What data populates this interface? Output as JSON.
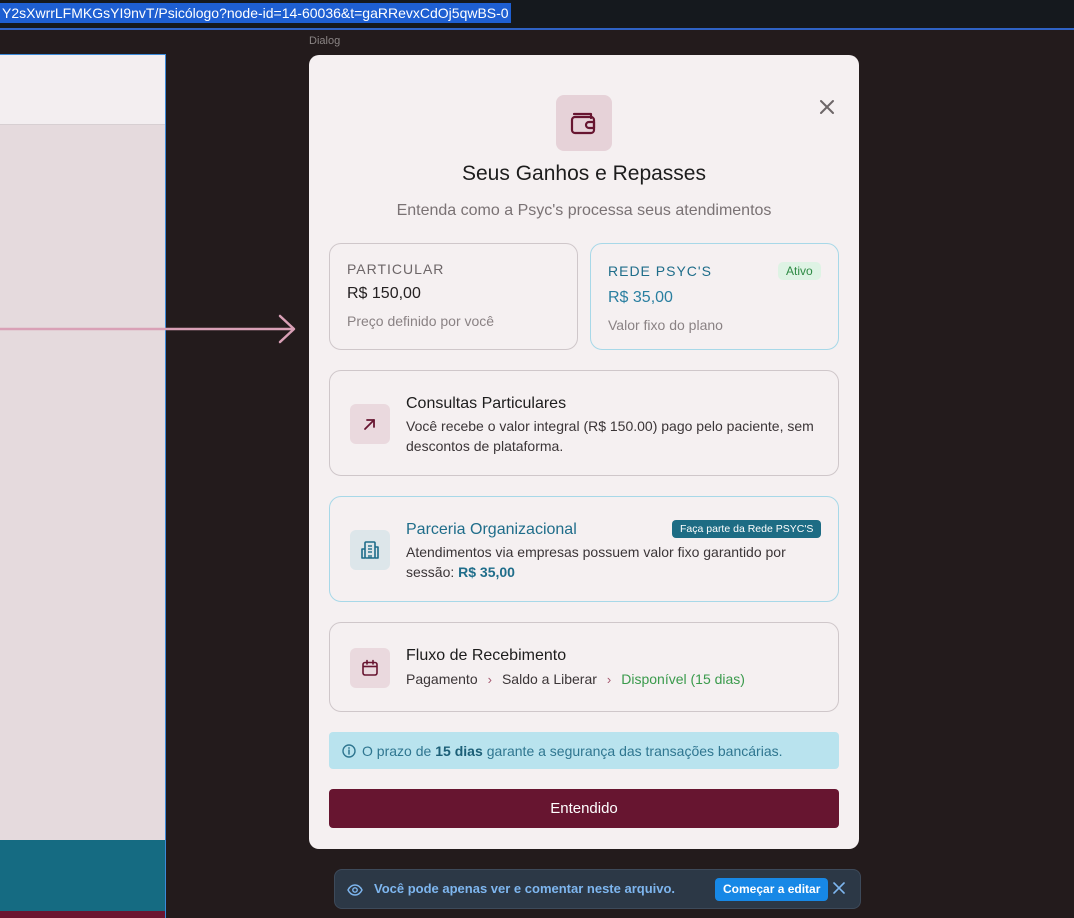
{
  "browser": {
    "url": "Y2sXwrrLFMKGsYI9nvT/Psicólogo?node-id=14-60036&t=gaRRevxCdOj5qwBS-0"
  },
  "canvas": {
    "frame_label": "Dialog"
  },
  "dialog": {
    "title": "Seus Ganhos e Repasses",
    "subtitle": "Entenda como a Psyc's processa seus atendimentos",
    "icon": "wallet-icon",
    "particular_card": {
      "label": "PARTICULAR",
      "price": "R$ 150,00",
      "note": "Preço definido por você"
    },
    "rede_card": {
      "label": "REDE PSYC'S",
      "badge": "Ativo",
      "price": "R$ 35,00",
      "note": "Valor fixo do plano"
    },
    "consultas": {
      "title": "Consultas Particulares",
      "text": "Você recebe o valor integral (R$ 150.00) pago pelo paciente, sem descontos de plataforma.",
      "icon": "arrow-up-right-icon"
    },
    "parceria": {
      "title": "Parceria Organizacional",
      "badge": "Faça parte da Rede PSYC'S",
      "text": "Atendimentos via empresas possuem valor fixo garantido por sessão:",
      "highlight": "R$ 35,00",
      "icon": "building-icon"
    },
    "fluxo": {
      "title": "Fluxo de Recebimento",
      "steps": [
        "Pagamento",
        "Saldo a Liberar",
        "Disponível (15 dias)"
      ],
      "icon": "calendar-icon"
    },
    "notice": {
      "prefix": "O prazo de",
      "emphasis": "15 dias",
      "suffix": "garante a segurança das transações bancárias."
    },
    "confirm_label": "Entendido"
  },
  "toast": {
    "message": "Você pode apenas ver e comentar neste arquivo.",
    "action_label": "Começar a editar"
  },
  "colors": {
    "primary": "#671530",
    "accent_blue": "#1f6d8a",
    "success": "#3a9a4c"
  }
}
